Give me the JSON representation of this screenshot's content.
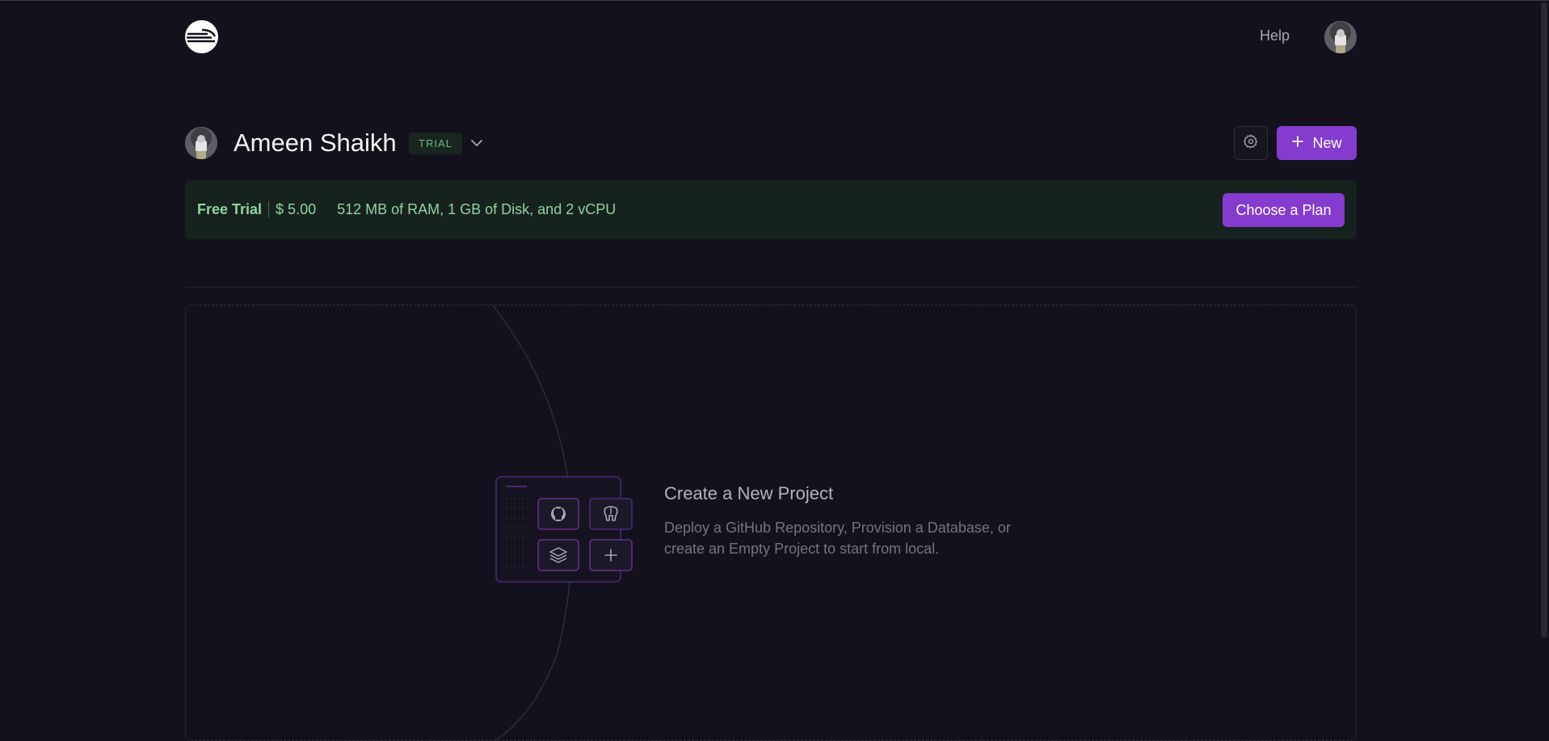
{
  "header": {
    "help_label": "Help"
  },
  "workspace": {
    "name": "Ameen Shaikh",
    "badge": "TRIAL"
  },
  "actions": {
    "new_label": "New"
  },
  "banner": {
    "plan": "Free Trial",
    "credit": "$ 5.00",
    "specs": "512 MB of RAM, 1 GB of Disk, and 2 vCPU",
    "cta_label": "Choose a Plan"
  },
  "empty_state": {
    "title": "Create a New Project",
    "description": "Deploy a GitHub Repository, Provision a Database, or create an Empty Project to start from local."
  },
  "colors": {
    "background": "#13111c",
    "accent": "#853bce",
    "banner_bg": "#16221d",
    "banner_text": "#8fd3a6"
  },
  "icons": [
    "railway-logo-icon",
    "user-avatar",
    "chevron-down-icon",
    "gear-icon",
    "plus-icon",
    "github-icon",
    "postgres-elephant-icon",
    "layers-icon"
  ]
}
